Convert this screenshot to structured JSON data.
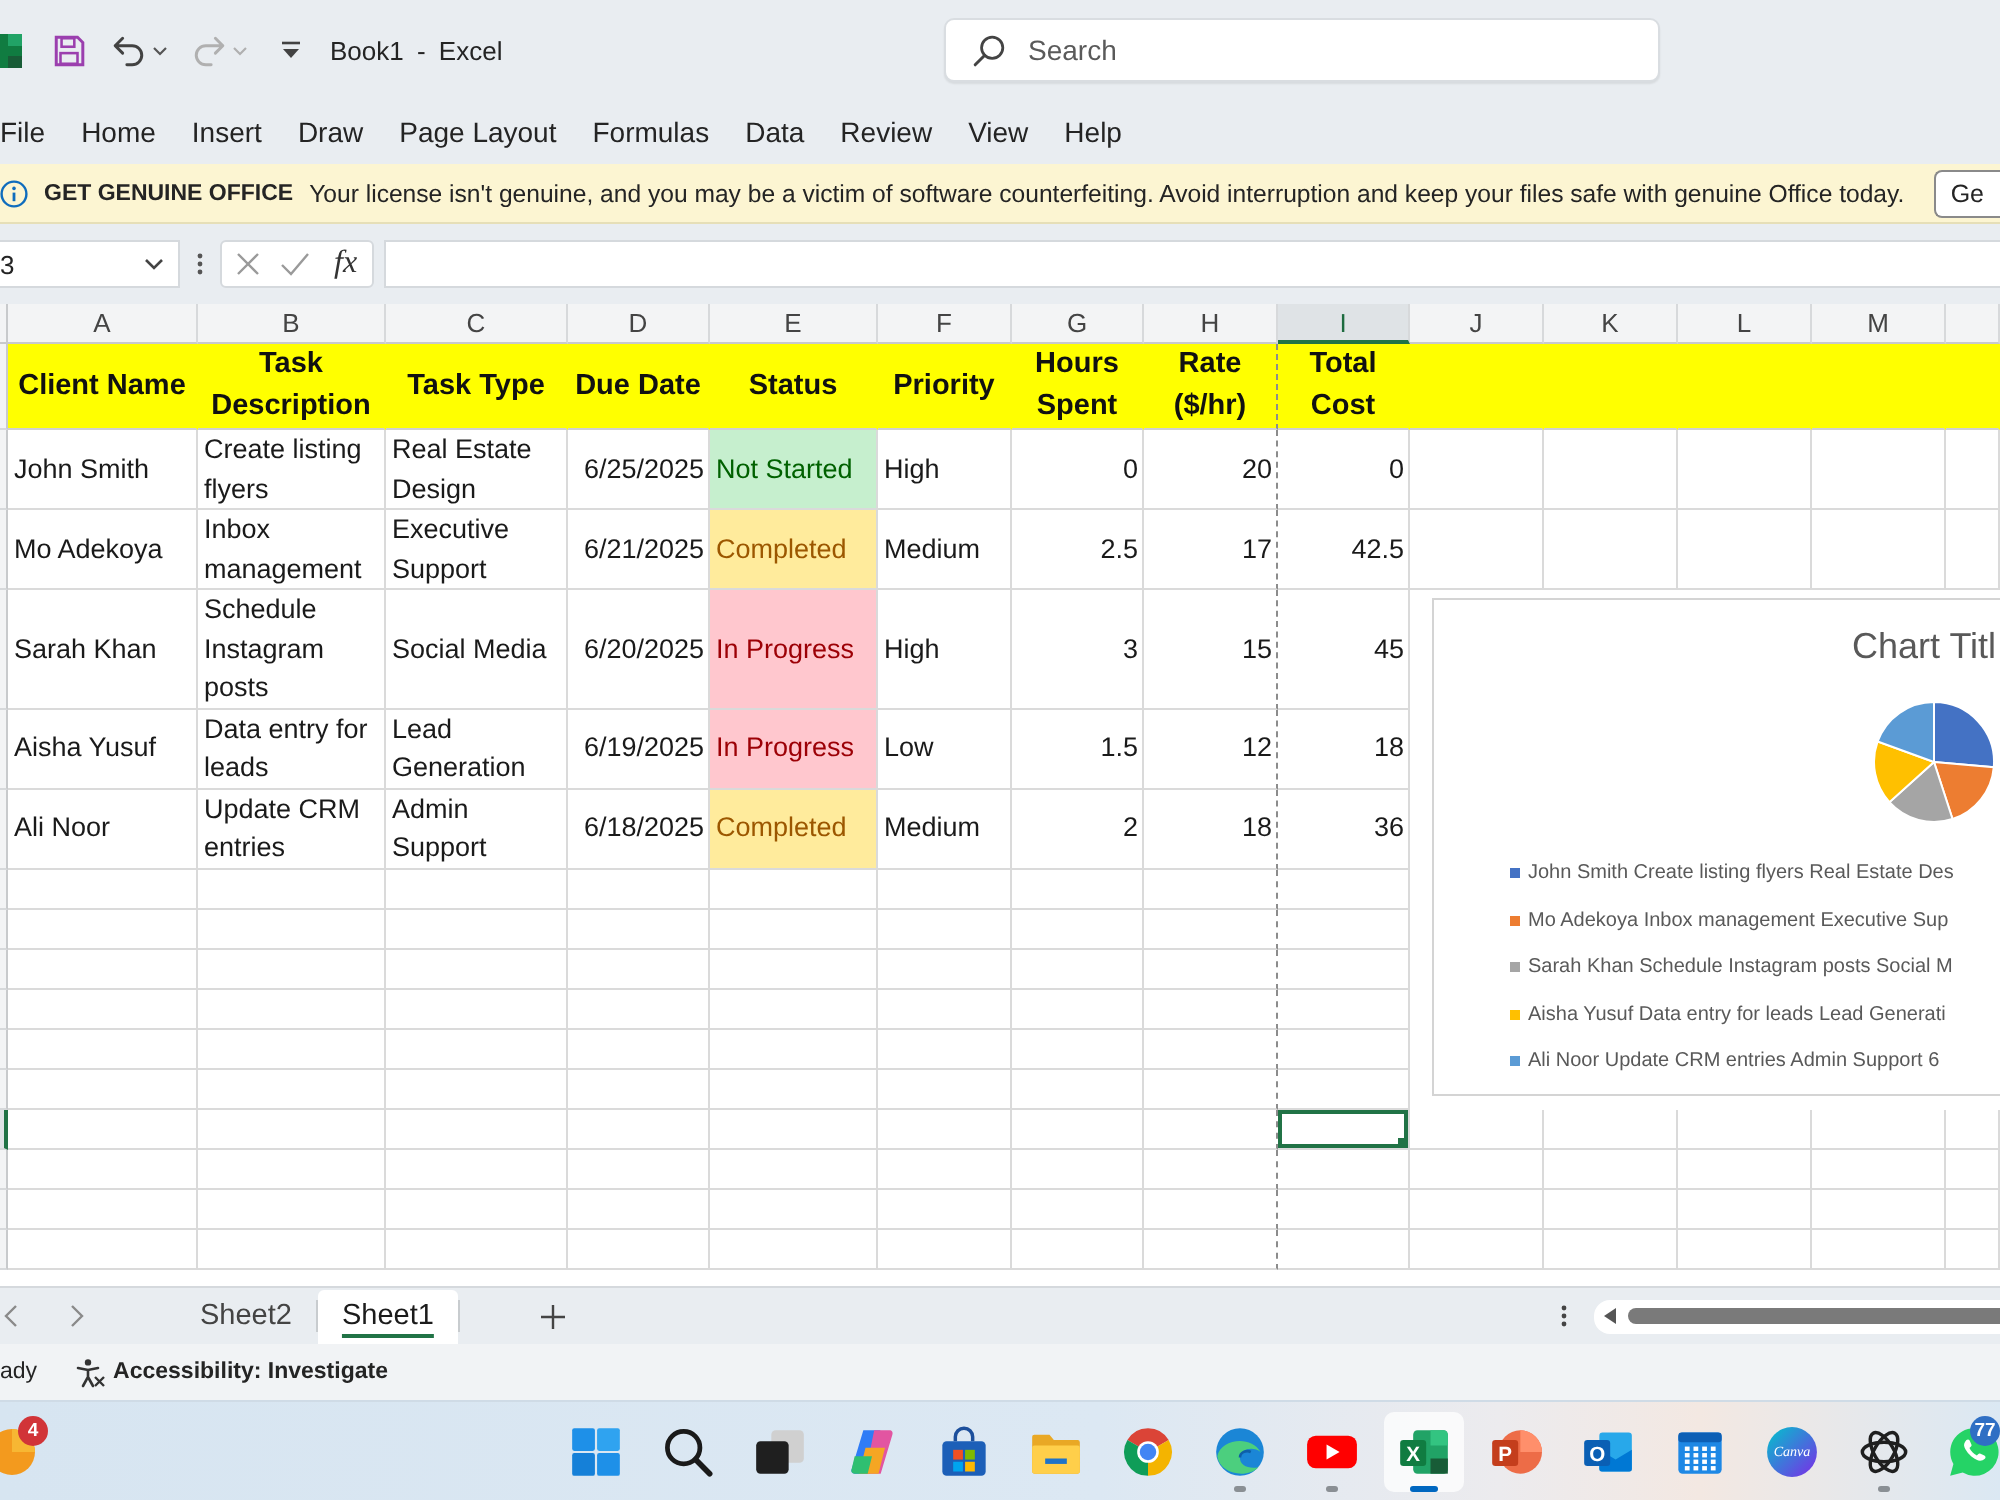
{
  "title_bar": {
    "quick_access": [
      {
        "kind": "save",
        "disabled": false
      },
      {
        "kind": "undo",
        "disabled": false
      },
      {
        "kind": "redo",
        "disabled": true
      },
      {
        "kind": "customize",
        "disabled": false
      }
    ],
    "title": "Book1 - Excel",
    "search": {
      "placeholder": "Search"
    }
  },
  "ribbon_tabs": [
    "File",
    "Home",
    "Insert",
    "Draw",
    "Page Layout",
    "Formulas",
    "Data",
    "Review",
    "View",
    "Help"
  ],
  "message_bar": {
    "title": "GET GENUINE OFFICE",
    "text": "Your license isn't genuine, and you may be a victim of software counterfeiting. Avoid interruption and keep your files safe with genuine Office today.",
    "button": "Ge"
  },
  "formula_bar": {
    "name_box": "3",
    "function_label": "fx"
  },
  "column_headers": [
    {
      "label": "A",
      "selected": false
    },
    {
      "label": "B",
      "selected": false
    },
    {
      "label": "C",
      "selected": false
    },
    {
      "label": "D",
      "selected": false
    },
    {
      "label": "E",
      "selected": false
    },
    {
      "label": "F",
      "selected": false
    },
    {
      "label": "G",
      "selected": false
    },
    {
      "label": "H",
      "selected": false
    },
    {
      "label": "I",
      "selected": true
    },
    {
      "label": "J",
      "selected": false
    },
    {
      "label": "K",
      "selected": false
    },
    {
      "label": "L",
      "selected": false
    },
    {
      "label": "M",
      "selected": false
    }
  ],
  "table": {
    "columns": [
      "Client Name",
      "Task Description",
      "Task Type",
      "Due Date",
      "Status",
      "Priority",
      "Hours Spent",
      "Rate ($/hr)",
      "Total Cost"
    ],
    "rows": [
      {
        "client": "John Smith",
        "description": "Create listing flyers",
        "task_type": "Real Estate Design",
        "due_date": "6/25/2025",
        "status": {
          "text": "Not Started",
          "kind": "good"
        },
        "priority": "High",
        "hours_spent": "0",
        "rate": "20",
        "total_cost": "0"
      },
      {
        "client": "Mo Adekoya",
        "description": "Inbox management",
        "task_type": "Executive Support",
        "due_date": "6/21/2025",
        "status": {
          "text": "Completed",
          "kind": "neutral"
        },
        "priority": "Medium",
        "hours_spent": "2.5",
        "rate": "17",
        "total_cost": "42.5"
      },
      {
        "client": "Sarah Khan",
        "description": "Schedule Instagram posts",
        "task_type": "Social Media",
        "due_date": "6/20/2025",
        "status": {
          "text": "In Progress",
          "kind": "bad"
        },
        "priority": "High",
        "hours_spent": "3",
        "rate": "15",
        "total_cost": "45"
      },
      {
        "client": "Aisha Yusuf",
        "description": "Data entry for leads",
        "task_type": "Lead Generation",
        "due_date": "6/19/2025",
        "status": {
          "text": "In Progress",
          "kind": "bad"
        },
        "priority": "Low",
        "hours_spent": "1.5",
        "rate": "12",
        "total_cost": "18"
      },
      {
        "client": "Ali Noor",
        "description": "Update CRM entries",
        "task_type": "Admin Support",
        "due_date": "6/18/2025",
        "status": {
          "text": "Completed",
          "kind": "neutral"
        },
        "priority": "Medium",
        "hours_spent": "2",
        "rate": "18",
        "total_cost": "36"
      }
    ]
  },
  "blank_rows": [
    {
      "selected": false
    },
    {
      "selected": false
    },
    {
      "selected": false
    },
    {
      "selected": false
    },
    {
      "selected": false
    },
    {
      "selected": false
    },
    {
      "selected": true
    },
    {
      "selected": false
    },
    {
      "selected": false
    },
    {
      "selected": false
    }
  ],
  "chart": {
    "title": "Chart Titl",
    "legend": [
      {
        "label": "John Smith Create listing flyers Real Estate Des",
        "color": "#4472c4"
      },
      {
        "label": "Mo Adekoya Inbox management Executive Sup",
        "color": "#ed7d31"
      },
      {
        "label": "Sarah Khan Schedule Instagram posts Social M",
        "color": "#a5a5a5"
      },
      {
        "label": "Aisha Yusuf Data entry for leads Lead Generati",
        "color": "#ffc000"
      },
      {
        "label": "Ali Noor Update CRM entries Admin Support 6",
        "color": "#5b9bd5"
      }
    ]
  },
  "sheet_tabs": [
    {
      "label": "Sheet2",
      "selected": false
    },
    {
      "label": "Sheet1",
      "selected": true
    }
  ],
  "status_bar": {
    "mode": "ady",
    "accessibility": "Accessibility: Investigate"
  },
  "taskbar": [
    {
      "kind": "widget",
      "badge": "4",
      "running": false,
      "selected": false
    },
    {
      "kind": "start",
      "running": false,
      "selected": false
    },
    {
      "kind": "search",
      "running": false,
      "selected": false
    },
    {
      "kind": "task_view",
      "running": false,
      "selected": false
    },
    {
      "kind": "assistant",
      "running": false,
      "selected": false
    },
    {
      "kind": "store",
      "running": false,
      "selected": false
    },
    {
      "kind": "files",
      "running": false,
      "selected": false
    },
    {
      "kind": "browser",
      "running": false,
      "selected": false
    },
    {
      "kind": "browser_wave",
      "running": true,
      "selected": false
    },
    {
      "kind": "video",
      "running": true,
      "selected": false
    },
    {
      "kind": "spreadsheet",
      "glyph": "X",
      "running": true,
      "selected": true
    },
    {
      "kind": "slides",
      "glyph": "P",
      "running": false,
      "selected": false
    },
    {
      "kind": "mail",
      "glyph": "O",
      "running": false,
      "selected": false
    },
    {
      "kind": "calendar",
      "running": false,
      "selected": false
    },
    {
      "kind": "design",
      "glyph": "Canva",
      "running": false,
      "selected": false
    },
    {
      "kind": "chat_ai",
      "running": true,
      "selected": false
    },
    {
      "kind": "messenger",
      "badge": "77",
      "running": false,
      "selected": false
    }
  ]
}
